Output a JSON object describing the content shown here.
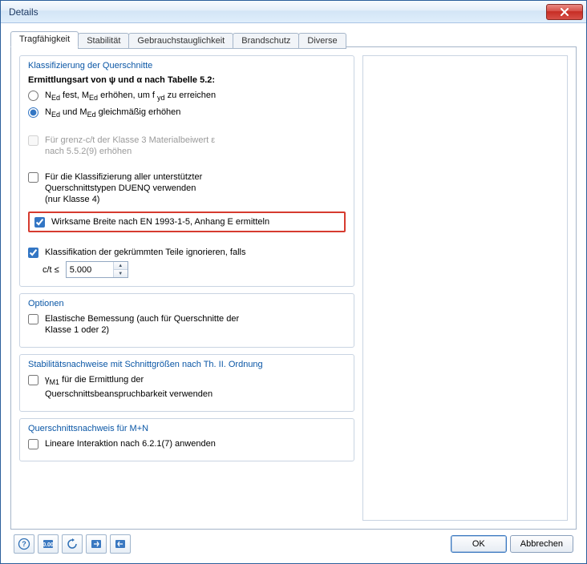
{
  "window": {
    "title": "Details"
  },
  "tabs": [
    "Tragfähigkeit",
    "Stabilität",
    "Gebrauchstauglichkeit",
    "Brandschutz",
    "Diverse"
  ],
  "group1": {
    "title": "Klassifizierung der Querschnitte",
    "subtitle": "Ermittlungsart von ψ und α nach Tabelle 5.2:",
    "radio1_pre": "N",
    "radio1_sub1": "Ed",
    "radio1_mid1": " fest, M",
    "radio1_sub2": "Ed",
    "radio1_mid2": " erhöhen, um f ",
    "radio1_sub3": "yd",
    "radio1_post": " zu erreichen",
    "radio2_pre": "N",
    "radio2_sub1": "Ed",
    "radio2_mid1": " und M",
    "radio2_sub2": "Ed",
    "radio2_post": " gleichmäßig erhöhen",
    "chk_grenz_line1": "Für grenz-c/t der Klasse 3 Materialbeiwert ε",
    "chk_grenz_line2": "nach 5.5.2(9) erhöhen",
    "chk_duenq_line1": "Für die Klassifizierung aller unterstützter",
    "chk_duenq_line2": "Querschnittstypen DUENQ verwenden",
    "chk_duenq_line3": "(nur Klasse 4)",
    "chk_highlight": "Wirksame Breite nach EN 1993-1-5, Anhang E ermitteln",
    "chk_curved": "Klassifikation der gekrümmten Teile ignorieren, falls",
    "ct_label": "c/t ≤",
    "ct_value": "5.000"
  },
  "group2": {
    "title": "Optionen",
    "chk_line1": "Elastische Bemessung (auch für Querschnitte der",
    "chk_line2": "Klasse 1 oder 2)"
  },
  "group3": {
    "title": "Stabilitätsnachweise mit Schnittgrößen nach Th. II. Ordnung",
    "chk_pre": "γ",
    "chk_sub": "M1",
    "chk_mid": " für die Ermittlung der",
    "chk_line2": "Querschnittsbeanspruchbarkeit verwenden"
  },
  "group4": {
    "title": "Querschnittsnachweis für M+N",
    "chk": "Lineare Interaktion nach 6.2.1(7) anwenden"
  },
  "buttons": {
    "ok": "OK",
    "cancel": "Abbrechen"
  }
}
